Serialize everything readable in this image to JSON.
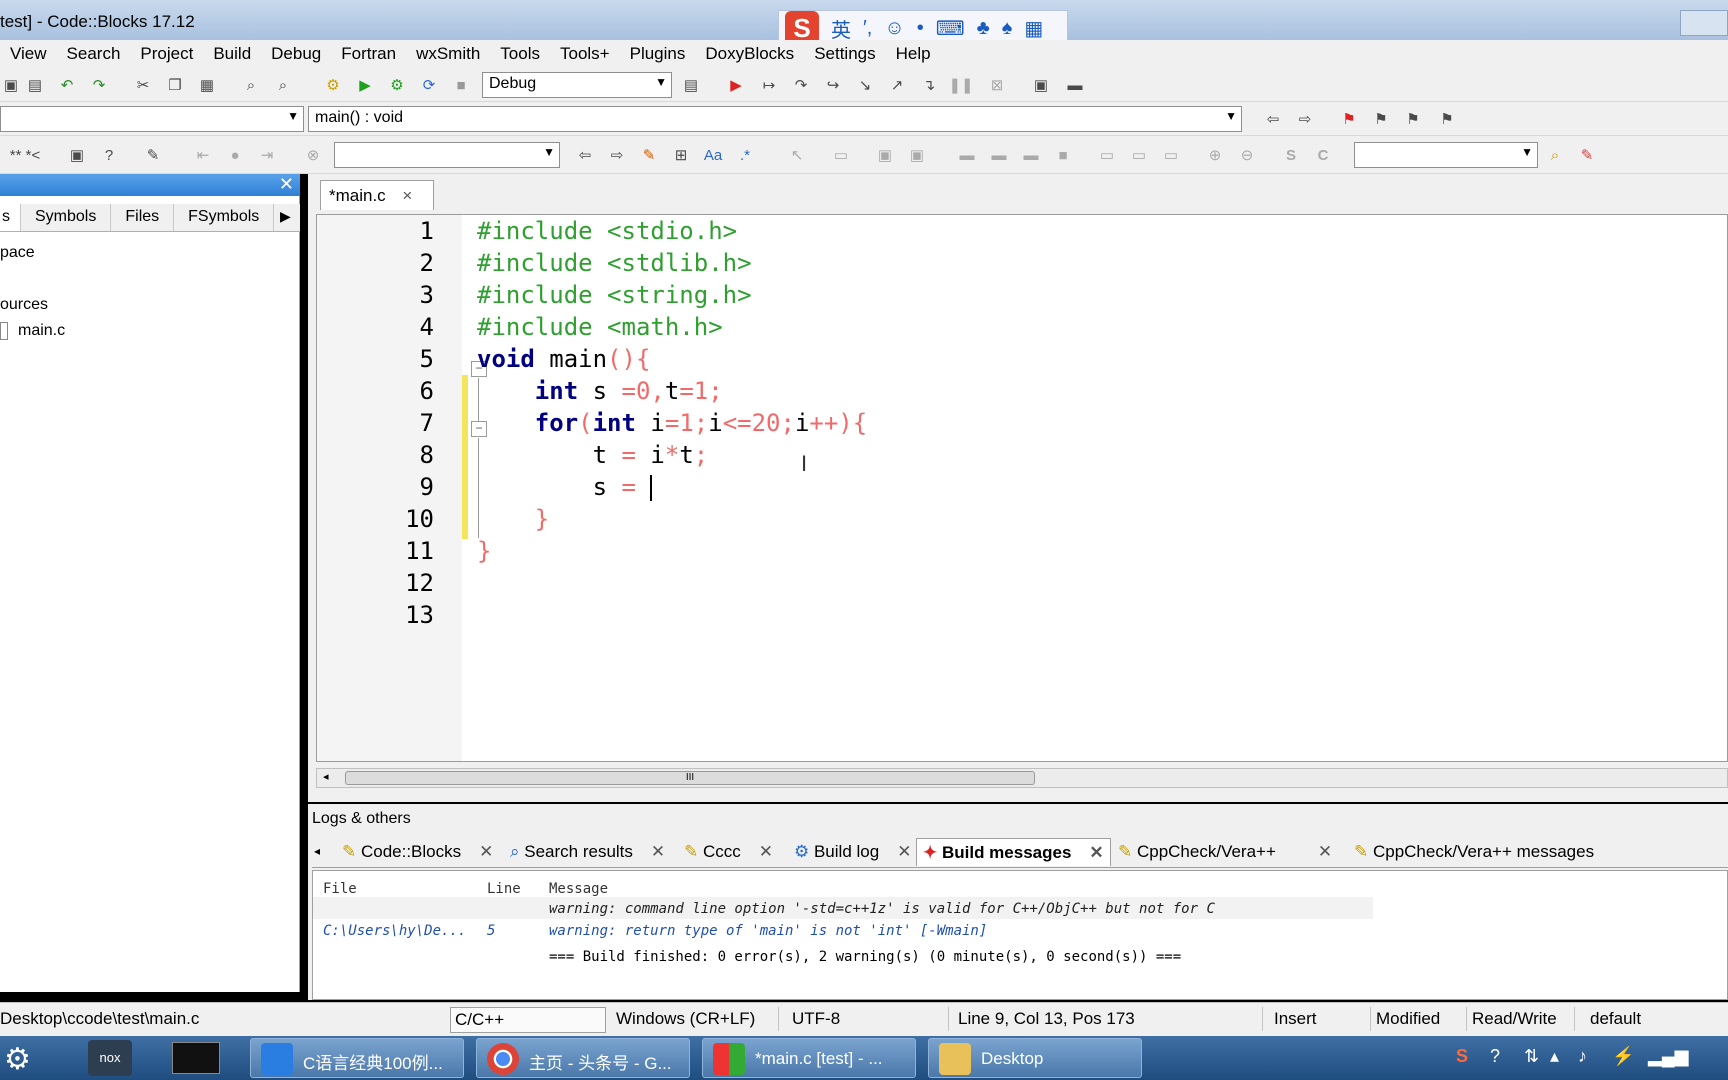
{
  "window": {
    "title": "test] - Code::Blocks 17.12"
  },
  "ime": {
    "logo": "S",
    "mode": "英",
    "punct": "′,",
    "emoji": "☺",
    "mic": "•",
    "keyboard": "⌨",
    "skin": "♣",
    "shirt": "♠",
    "grid": "▦"
  },
  "menu": [
    "View",
    "Search",
    "Project",
    "Build",
    "Debug",
    "Fortran",
    "wxSmith",
    "Tools",
    "Tools+",
    "Plugins",
    "DoxyBlocks",
    "Settings",
    "Help"
  ],
  "toolbar": {
    "build_target": "Debug",
    "function_scope": "main() : void"
  },
  "left_panel": {
    "tabs": [
      "s",
      "Symbols",
      "Files",
      "FSymbols"
    ],
    "tree": {
      "workspace": "pace",
      "sources": "ources",
      "file": "main.c"
    }
  },
  "editor": {
    "tab_label": "*main.c",
    "tab_close": "×",
    "line_numbers": [
      "1",
      "2",
      "3",
      "4",
      "5",
      "6",
      "7",
      "8",
      "9",
      "10",
      "11",
      "12",
      "13"
    ],
    "lines": {
      "l1": "#include <stdio.h>",
      "l2": "#include <stdlib.h>",
      "l3": "#include <string.h>",
      "l4": "#include <math.h>",
      "l5_kw": "void",
      "l5_rest": " main",
      "l5_paren": "(){",
      "l6_kw": "int",
      "l6_a": " s ",
      "l6_b": "=0,",
      "l6_c": "t",
      "l6_d": "=1;",
      "l7_kw": "for",
      "l7_a": "(",
      "l7_kw2": "int",
      "l7_b": " i",
      "l7_c": "=1;",
      "l7_d": "i",
      "l7_e": "<=20;",
      "l7_f": "i",
      "l7_g": "++){",
      "l8_a": "t",
      "l8_b": " = ",
      "l8_c": "i",
      "l8_d": "*",
      "l8_e": "t",
      "l8_f": ";",
      "l9_a": "s",
      "l9_b": " = ",
      "l10": "}",
      "l11": "}"
    },
    "scroll_grip": "III"
  },
  "logs": {
    "title": "Logs & others",
    "tabs": [
      "Code::Blocks",
      "Search results",
      "Cccc",
      "Build log",
      "Build messages",
      "CppCheck/Vera++",
      "CppCheck/Vera++ messages"
    ],
    "active_tab": "Build messages",
    "columns": [
      "File",
      "Line",
      "Message"
    ],
    "rows": [
      {
        "file": "",
        "line": "",
        "message": "warning: command line option '-std=c++1z' is valid for C++/ObjC++ but not for C"
      },
      {
        "file": "C:\\Users\\hy\\De...",
        "line": "5",
        "message": "warning: return type of 'main' is not 'int' [-Wmain]"
      },
      {
        "file": "",
        "line": "",
        "message": "=== Build finished: 0 error(s), 2 warning(s) (0 minute(s), 0 second(s)) ==="
      }
    ]
  },
  "status": {
    "path": "Desktop\\ccode\\test\\main.c",
    "language": "C/C++",
    "eol": "Windows (CR+LF)",
    "encoding": "UTF-8",
    "position": "Line 9, Col 13, Pos 173",
    "mode": "Insert",
    "modified": "Modified",
    "access": "Read/Write",
    "theme": "default"
  },
  "taskbar": {
    "items": [
      "C语言经典100例...",
      "主页 - 头条号 - G...",
      "*main.c [test] - ...",
      "Desktop"
    ]
  },
  "colors": {
    "preprocessor": "#2f9f2f",
    "keyword": "#000080",
    "number": "#f06a6a",
    "changebar": "#f4e65c"
  }
}
